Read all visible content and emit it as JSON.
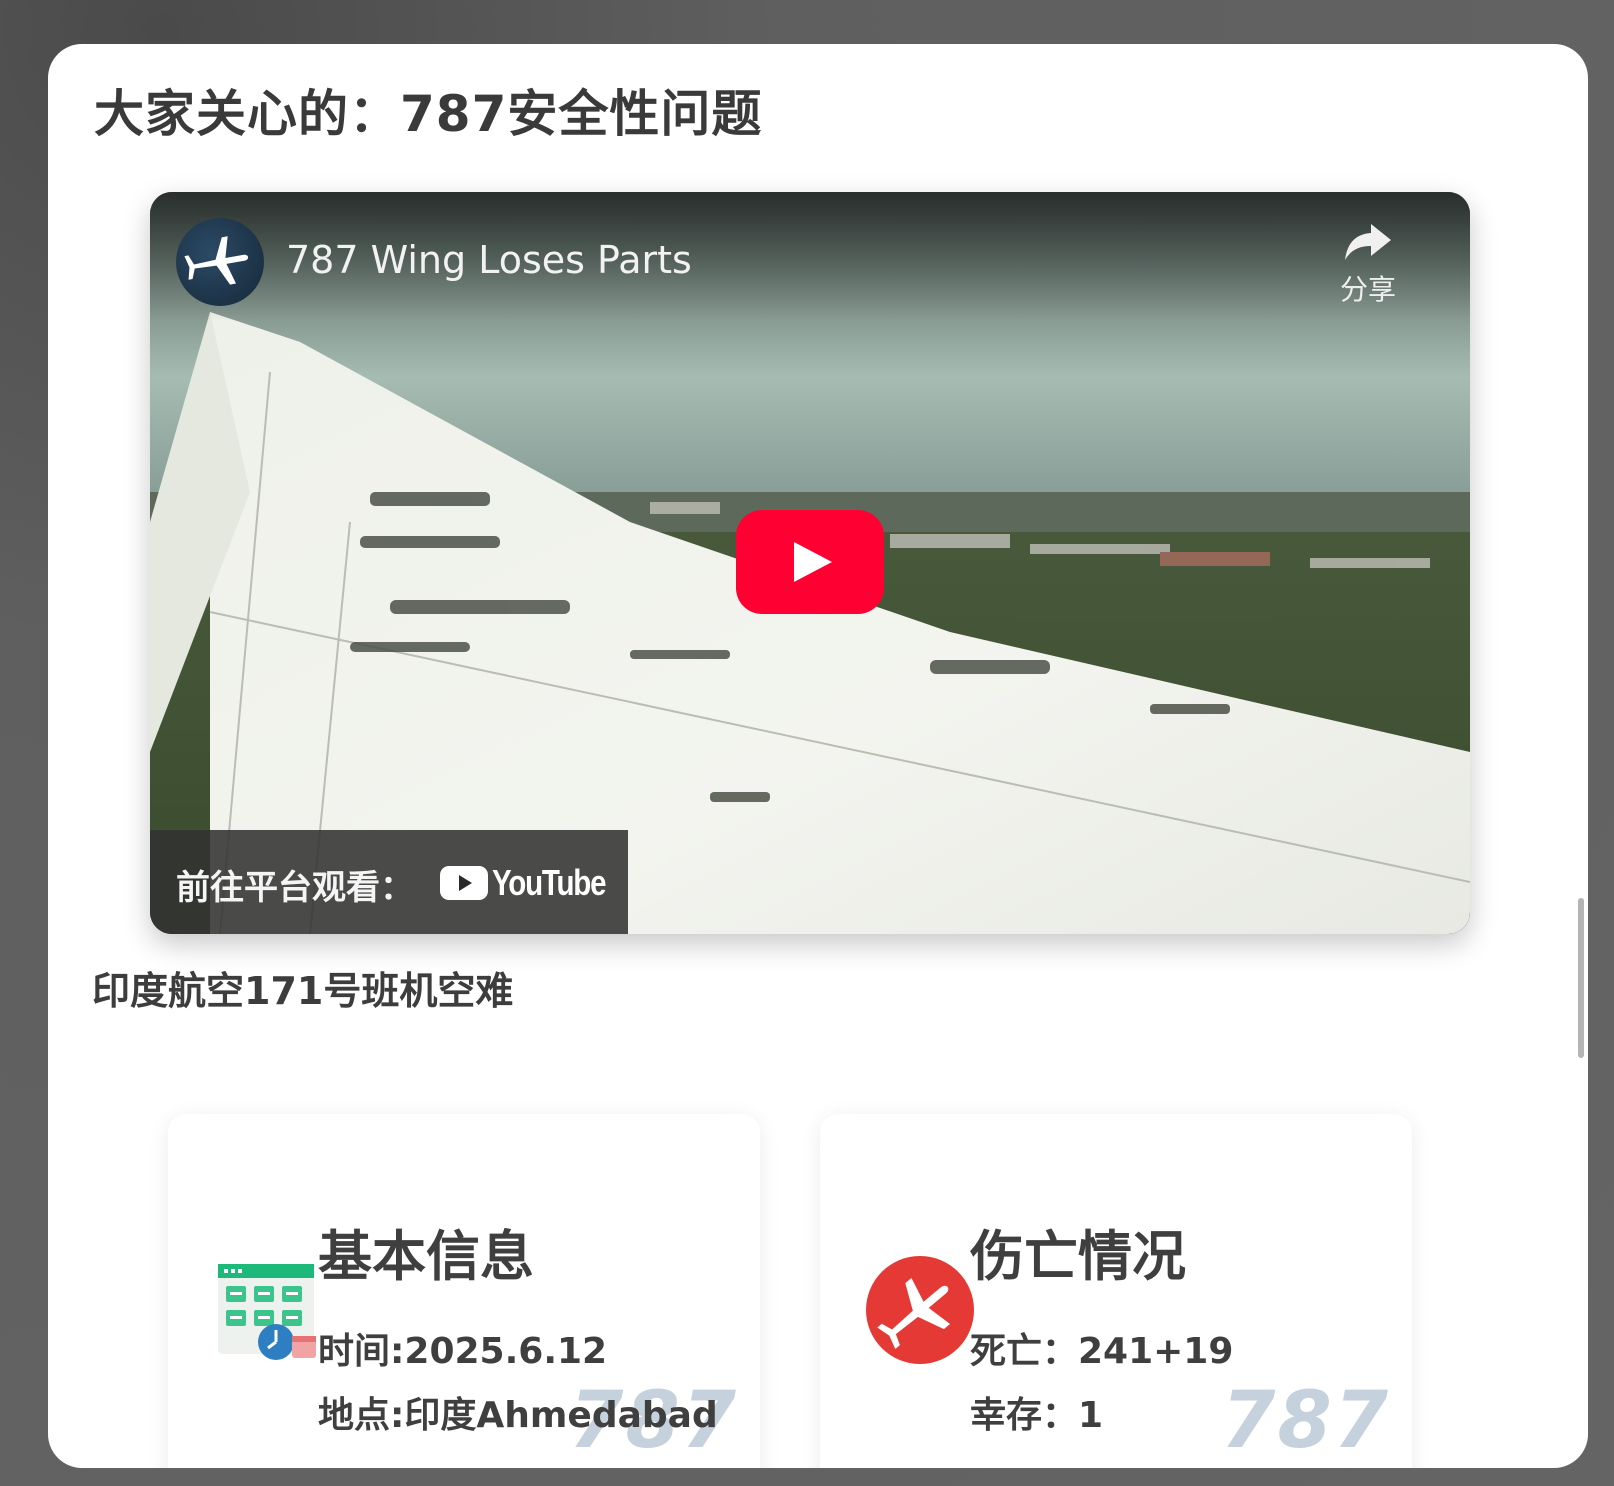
{
  "page": {
    "title": "大家关心的：787安全性问题"
  },
  "video": {
    "title": "787 Wing Loses Parts",
    "channel_icon": "airplane-icon",
    "share_label": "分享",
    "watch_on_label": "前往平台观看：",
    "platform_name": "YouTube",
    "play_color": "#ff0033"
  },
  "section": {
    "title": "印度航空171号班机空难"
  },
  "cards": [
    {
      "title": "基本信息",
      "icon": "calendar-clock-icon",
      "line1": "时间:2025.6.12",
      "line2": "地点:印度Ahmedabad",
      "watermark": "787"
    },
    {
      "title": "伤亡情况",
      "icon": "plane-crash-icon",
      "line1": "死亡：241+19",
      "line2": "幸存：1",
      "watermark": "787"
    }
  ],
  "colors": {
    "overlay": "#616161",
    "text": "#3f3f3f",
    "watermark": "#c6d1de",
    "crash_icon": "#e53935",
    "calendar_header": "#1db97a"
  }
}
